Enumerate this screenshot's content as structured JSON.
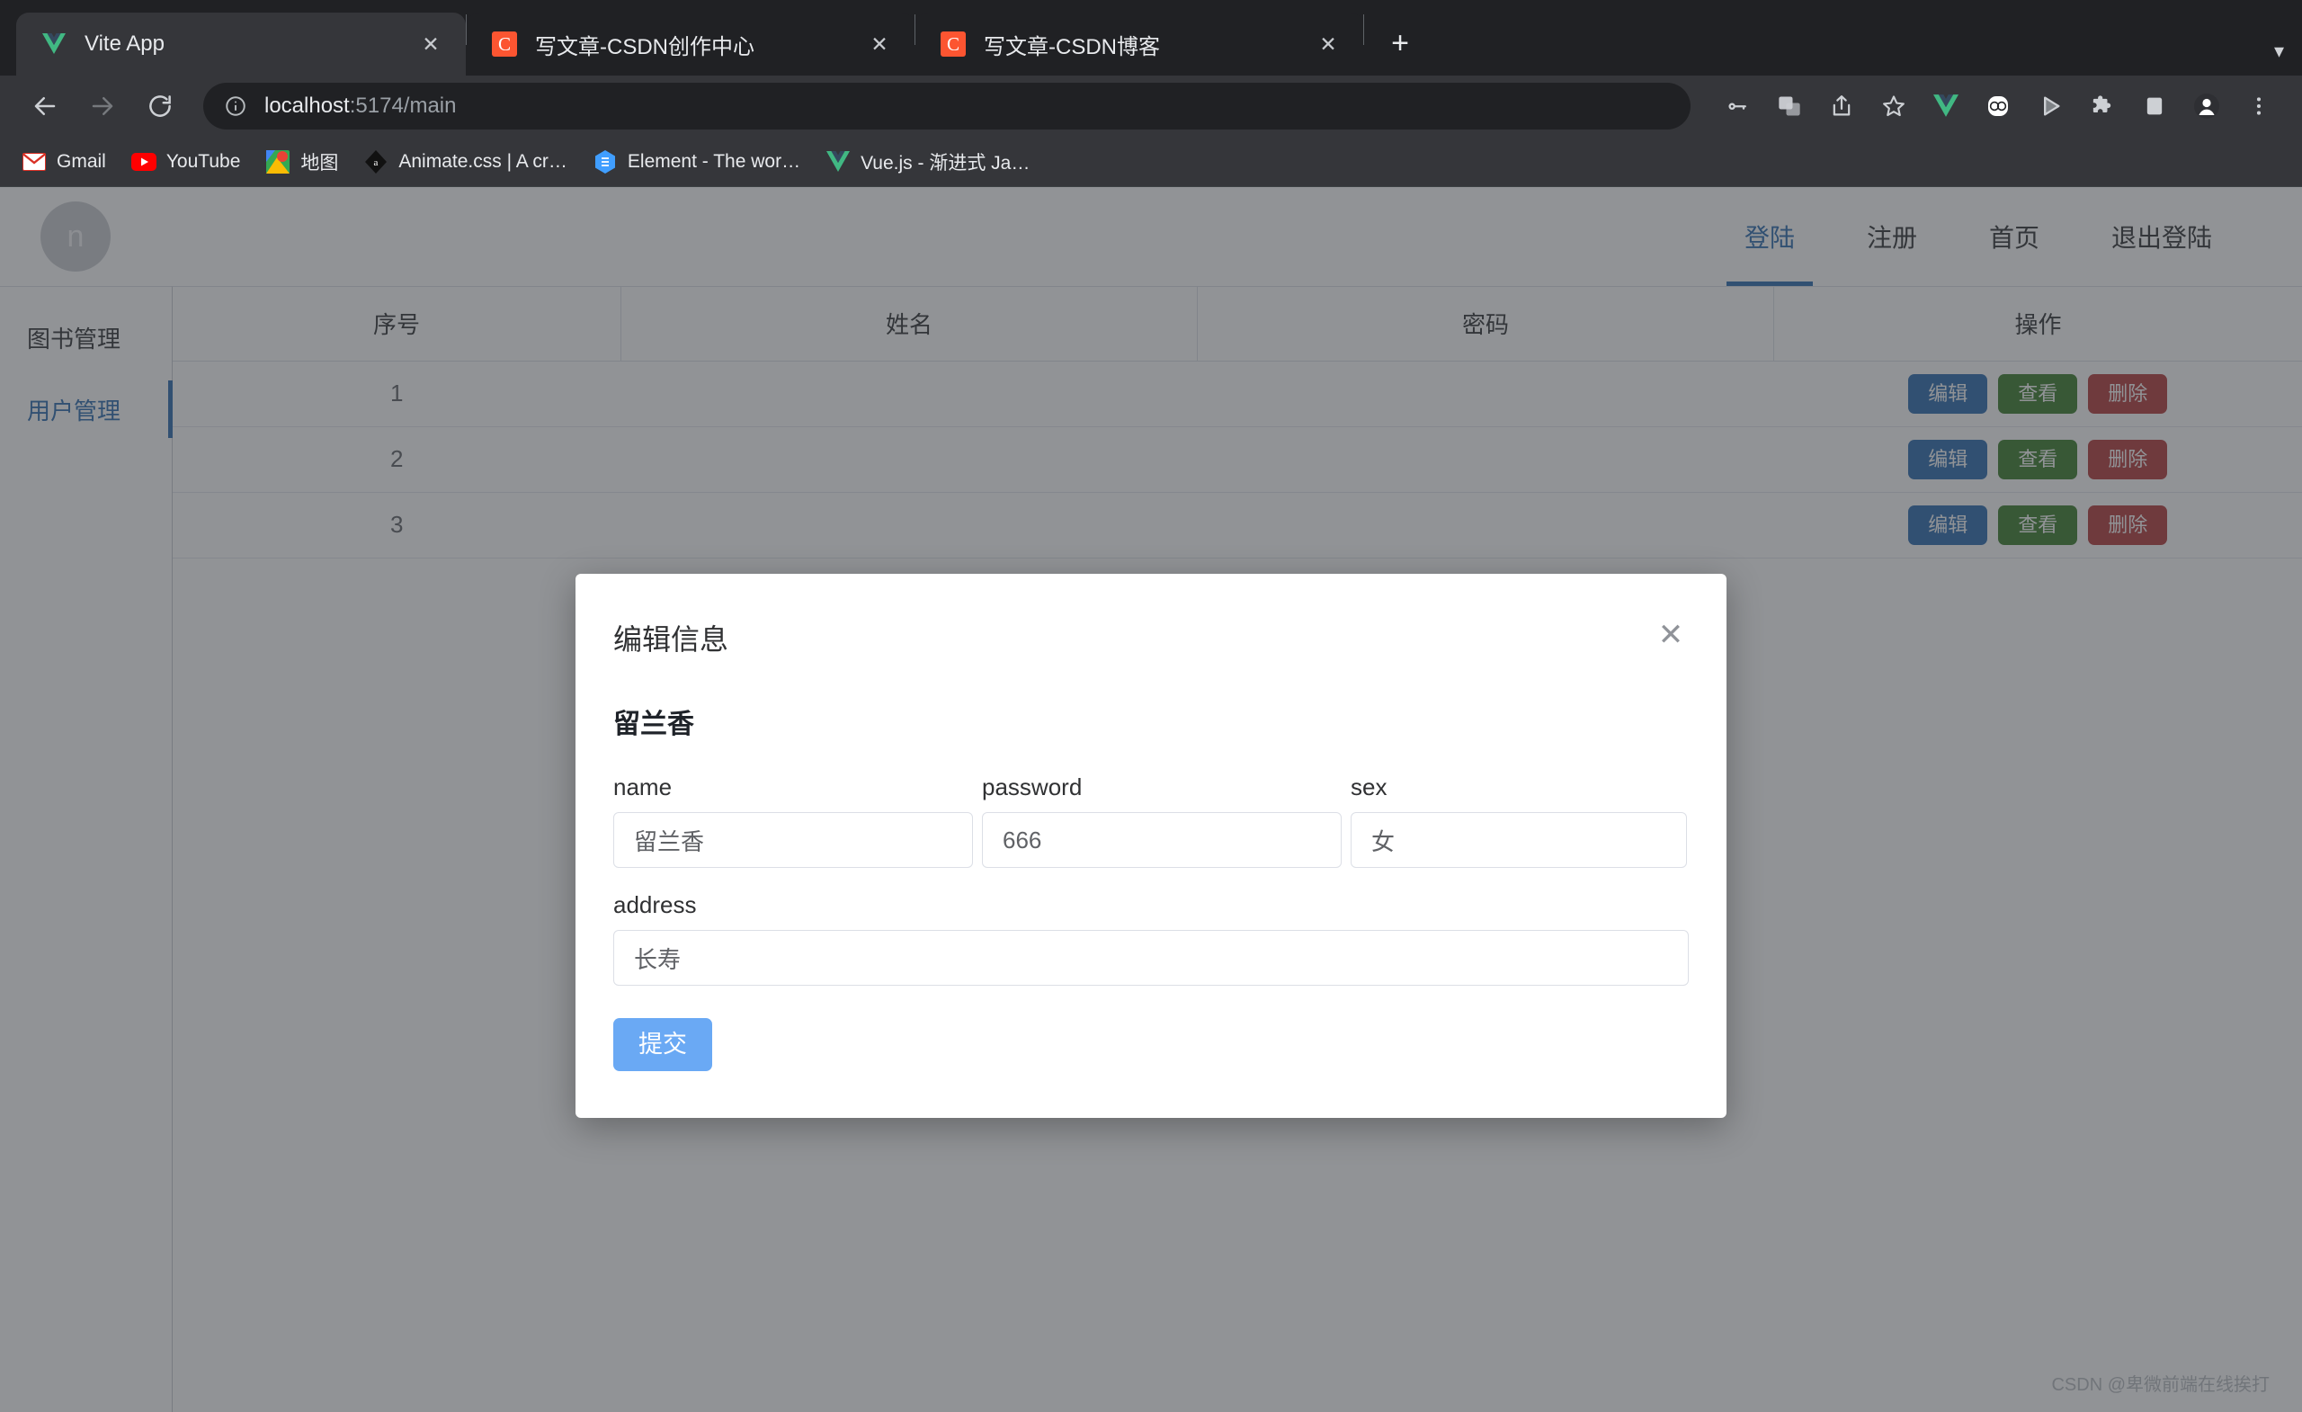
{
  "browser": {
    "tabs": [
      {
        "title": "Vite App",
        "favicon": "vue-logo-icon",
        "active": true
      },
      {
        "title": "写文章-CSDN创作中心",
        "favicon": "csdn-logo-icon",
        "active": false
      },
      {
        "title": "写文章-CSDN博客",
        "favicon": "csdn-logo-icon",
        "active": false
      }
    ],
    "new_tab_label": "+",
    "tab_list_chevron": "▾",
    "nav": {
      "back": "←",
      "forward": "→",
      "reload": "⟳"
    },
    "omnibox": {
      "icon": "info-circle-icon",
      "host": "localhost",
      "path": ":5174/main",
      "full_url": "localhost:5174/main"
    },
    "toolbar_icons": [
      "password-key-icon",
      "translate-icon",
      "share-icon",
      "bookmark-star-icon",
      "vue-devtools-icon",
      "glasses-extension-icon",
      "play-extension-icon",
      "extensions-puzzle-icon",
      "side-panel-icon",
      "profile-avatar-icon",
      "chrome-menu-icon"
    ],
    "bookmarks": [
      {
        "label": "Gmail",
        "icon": "gmail-icon"
      },
      {
        "label": "YouTube",
        "icon": "youtube-icon"
      },
      {
        "label": "地图",
        "icon": "google-maps-icon"
      },
      {
        "label": "Animate.css | A cr…",
        "icon": "animate-css-icon"
      },
      {
        "label": "Element - The wor…",
        "icon": "element-ui-icon"
      },
      {
        "label": "Vue.js - 渐进式 Ja…",
        "icon": "vue-logo-icon"
      }
    ]
  },
  "app": {
    "avatar_letter": "n",
    "nav": [
      {
        "label": "登陆",
        "active": true
      },
      {
        "label": "注册",
        "active": false
      },
      {
        "label": "首页",
        "active": false
      },
      {
        "label": "退出登陆",
        "active": false
      }
    ],
    "sidebar": [
      {
        "label": "图书管理",
        "active": false
      },
      {
        "label": "用户管理",
        "active": true
      }
    ],
    "table": {
      "headers": [
        "序号",
        "姓名",
        "密码",
        "操作"
      ],
      "rows": [
        {
          "index": "1",
          "name": "",
          "password": ""
        },
        {
          "index": "2",
          "name": "",
          "password": ""
        },
        {
          "index": "3",
          "name": "",
          "password": ""
        }
      ],
      "actions": {
        "edit": "编辑",
        "view": "查看",
        "delete": "删除"
      }
    },
    "watermark": "CSDN @卑微前端在线挨打"
  },
  "modal": {
    "title": "编辑信息",
    "close_icon": "close-icon",
    "subtitle": "留兰香",
    "fields": {
      "name": {
        "label": "name",
        "value": "留兰香"
      },
      "password": {
        "label": "password",
        "value": "666"
      },
      "sex": {
        "label": "sex",
        "value": "女"
      },
      "address": {
        "label": "address",
        "value": "长寿"
      }
    },
    "submit_label": "提交"
  },
  "colors": {
    "accent_blue": "#2b6cb0",
    "submit_blue": "#6aa9f4",
    "edit_blue": "#2b6cb0",
    "view_green": "#3a7d2c",
    "delete_red": "#b33a3a",
    "chrome_dark": "#202124",
    "toolbar_dark": "#35363a"
  }
}
